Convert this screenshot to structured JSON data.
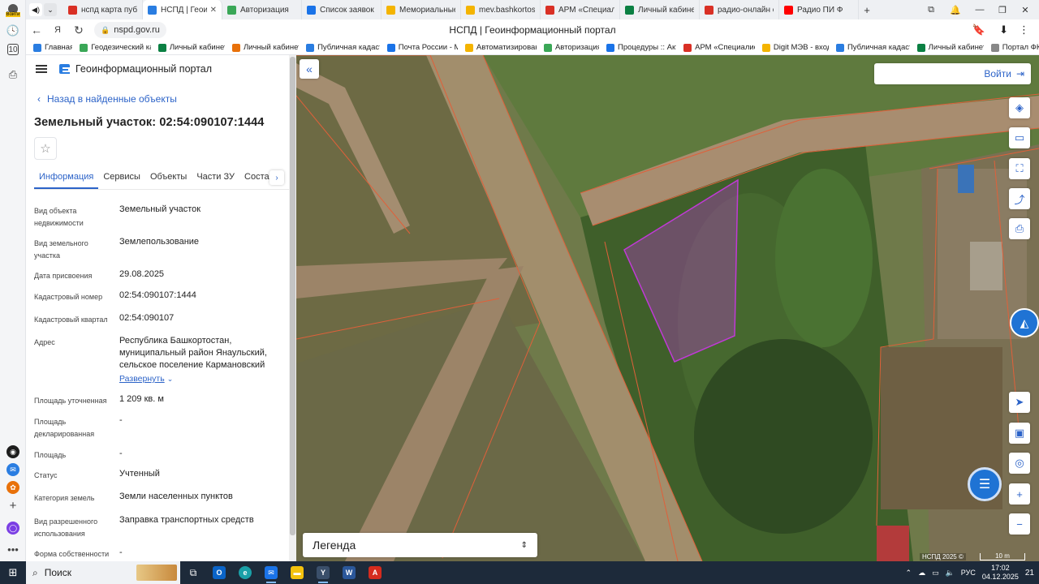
{
  "browser": {
    "rail_profile_label": "Войти",
    "tabs": [
      {
        "title": "нспд карта публи",
        "color": "#d93025",
        "active": false
      },
      {
        "title": "НСПД | Геоинф",
        "color": "#2a7de1",
        "active": true
      },
      {
        "title": "Авторизация",
        "color": "#3aa757",
        "active": false
      },
      {
        "title": "Список заявок —",
        "color": "#1a73e8",
        "active": false
      },
      {
        "title": "Мемориальные с",
        "color": "#f4b400",
        "active": false
      },
      {
        "title": "mev.bashkortosta",
        "color": "#f4b400",
        "active": false
      },
      {
        "title": "АРМ «Специалис",
        "color": "#d93025",
        "active": false
      },
      {
        "title": "Личный кабинет",
        "color": "#0b8043",
        "active": false
      },
      {
        "title": "радио-онлайн сл",
        "color": "#d93025",
        "active": false
      },
      {
        "title": "Радио ПИ Ф",
        "color": "#ff0000",
        "active": false
      }
    ],
    "url": "nspd.gov.ru",
    "page_title": "НСПД | Геоинформационный портал",
    "bookmarks": [
      {
        "label": "Главная",
        "color": "#2a7de1"
      },
      {
        "label": "Геодезический ка",
        "color": "#3aa757"
      },
      {
        "label": "Личный кабинет",
        "color": "#0b8043"
      },
      {
        "label": "Личный кабинет",
        "color": "#e8710a"
      },
      {
        "label": "Публичная кадаст",
        "color": "#2a7de1"
      },
      {
        "label": "Почта России - М",
        "color": "#1a73e8"
      },
      {
        "label": "Автоматизирован",
        "color": "#f4b400"
      },
      {
        "label": "Авторизация",
        "color": "#3aa757"
      },
      {
        "label": "Процедуры :: Акт",
        "color": "#1a73e8"
      },
      {
        "label": "АРМ «Специалис",
        "color": "#d93025"
      },
      {
        "label": "Digit МЭВ - вход",
        "color": "#f4b400"
      },
      {
        "label": "Публичная кадаст",
        "color": "#2a7de1"
      },
      {
        "label": "Личный кабинет",
        "color": "#0b8043"
      },
      {
        "label": "Портал ФК",
        "color": "#888888"
      }
    ]
  },
  "panel": {
    "portal_name": "Геоинформационный портал",
    "back_label": "Назад в найденные объекты",
    "title": "Земельный участок: 02:54:090107:1444",
    "tabs": [
      "Информация",
      "Сервисы",
      "Объекты",
      "Части ЗУ",
      "Соста"
    ],
    "active_tab": "Информация",
    "fields": [
      {
        "label": "Вид объекта недвижимости",
        "value": "Земельный участок"
      },
      {
        "label": "Вид земельного участка",
        "value": "Землепользование"
      },
      {
        "label": "Дата присвоения",
        "value": "29.08.2025"
      },
      {
        "label": "Кадастровый номер",
        "value": "02:54:090107:1444"
      },
      {
        "label": "Кадастровый квартал",
        "value": "02:54:090107"
      },
      {
        "label": "Адрес",
        "value": "Республика Башкортостан, муниципальный район Янаульский, сельское поселение Кармановский",
        "link": "Развернуть"
      },
      {
        "label": "Площадь уточненная",
        "value": "1 209 кв. м"
      },
      {
        "label": "Площадь декларированная",
        "value": "-"
      },
      {
        "label": "Площадь",
        "value": "-"
      },
      {
        "label": "Статус",
        "value": "Учтенный"
      },
      {
        "label": "Категория земель",
        "value": "Земли населенных пунктов"
      },
      {
        "label": "Вид разрешенного использования",
        "value": "Заправка транспортных средств"
      },
      {
        "label": "Форма собственности",
        "value": "-"
      }
    ]
  },
  "map": {
    "login_label": "Войти",
    "legend_label": "Легенда",
    "copyright": "НСПД 2025 ©",
    "scale": "10 m",
    "colors": {
      "selected_parcel": "#c03ad6",
      "boundary": "#e0603a",
      "accent": "#2c63c8"
    }
  },
  "taskbar": {
    "search_label": "Поиск",
    "lang": "РУС",
    "time": "17:02",
    "date": "04.12.2025",
    "notifications": "21"
  }
}
